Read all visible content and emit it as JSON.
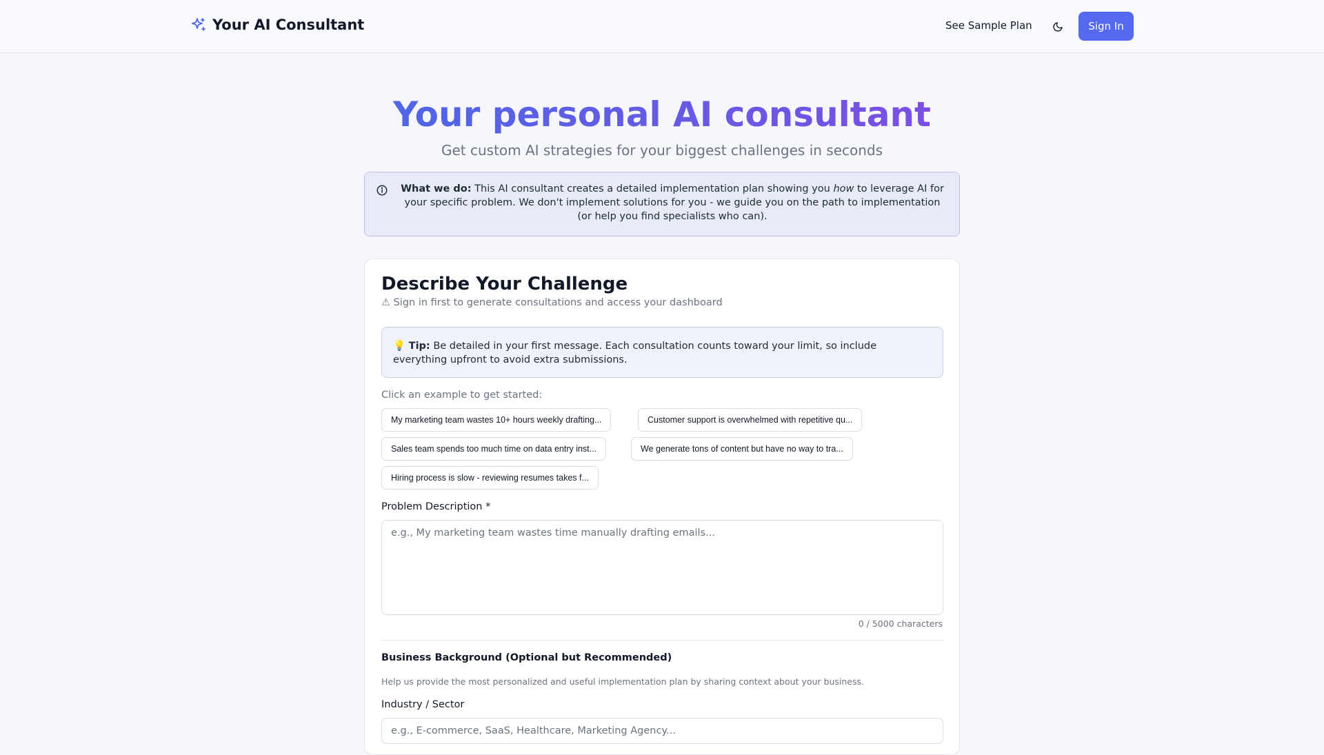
{
  "header": {
    "logo_text": "Your AI Consultant",
    "sample_plan_label": "See Sample Plan",
    "theme_toggle_icon": "moon-icon",
    "sign_in_label": "Sign In"
  },
  "hero": {
    "title": "Your personal AI consultant",
    "subtitle": "Get custom AI strategies for your biggest challenges in seconds"
  },
  "info": {
    "icon": "info-icon",
    "lead": "What we do:",
    "text_before": " This AI consultant creates a detailed implementation plan showing you ",
    "emphasis": "how",
    "text_after": " to leverage AI for your specific problem. We don't implement solutions for you - we guide you on the path to implementation (or help you find specialists who can)."
  },
  "form": {
    "title": "Describe Your Challenge",
    "warning": "⚠ Sign in first to generate consultations and access your dashboard",
    "tip": {
      "emoji": "💡",
      "lead": "Tip:",
      "text": " Be detailed in your first message. Each consultation counts toward your limit, so include everything upfront to avoid extra submissions."
    },
    "examples_label": "Click an example to get started:",
    "examples": [
      "My marketing team wastes 10+ hours weekly drafting...",
      "Customer support is overwhelmed with repetitive qu...",
      "Sales team spends too much time on data entry inst...",
      "We generate tons of content but have no way to tra...",
      "Hiring process is slow - reviewing resumes takes f..."
    ],
    "problem_label": "Problem Description *",
    "problem_placeholder": "e.g., My marketing team wastes time manually drafting emails...",
    "problem_value": "",
    "char_count": "0 / 5000 characters",
    "background_title": "Business Background (Optional but Recommended)",
    "background_desc": "Help us provide the most personalized and useful implementation plan by sharing context about your business.",
    "industry_label": "Industry / Sector",
    "industry_placeholder": "e.g., E-commerce, SaaS, Healthcare, Marketing Agency...",
    "industry_value": ""
  },
  "colors": {
    "accent": "#5469f0",
    "gradient_start": "#4f66e6",
    "gradient_end": "#7b4fe3"
  }
}
